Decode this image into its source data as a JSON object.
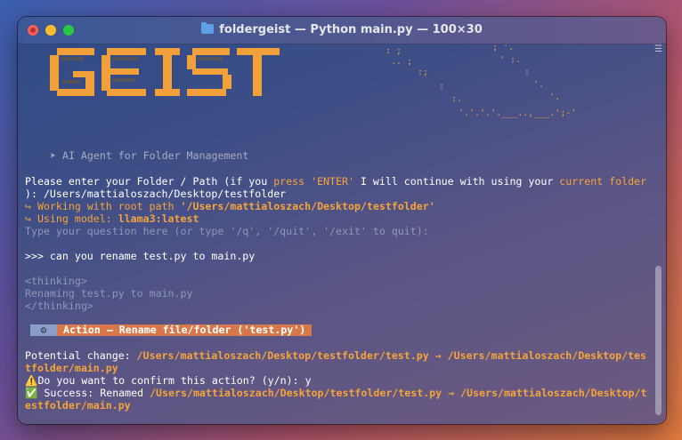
{
  "window": {
    "title": "foldergeist — Python main.py — 100×30"
  },
  "banner": {
    "subtitle": "➤ AI Agent for Folder Management"
  },
  "terminal": {
    "prompt_line1_a": "Please enter your Folder / Path (if you ",
    "prompt_line1_b": "press 'ENTER'",
    "prompt_line1_c": " I will continue with using your ",
    "prompt_line1_d": "current folder",
    "prompt_line2": "): /Users/mattialoszach/Desktop/testfolder",
    "working_prefix": "↪ Working with root path ",
    "working_path": "'/Users/mattialoszach/Desktop/testfolder'",
    "model_prefix": "↪ Using model: ",
    "model_name": "llama3:latest",
    "hint": "Type your question here (or type '/q', '/quit', '/exit' to quit):",
    "user_query": ">>> can you rename test.py to main.py",
    "thinking_open": "<thinking>",
    "thinking_body": "Renaming test.py to main.py",
    "thinking_close": "</thinking>",
    "action_gear": "⚙",
    "action_label": " Action – Rename file/folder ('test.py')",
    "potential_prefix": "Potential change: ",
    "potential_line1": "/Users/mattialoszach/Desktop/testfolder/test.py → /Users/mattialoszach/Desktop/tes",
    "potential_line2": "tfolder/main.py",
    "confirm_icon": "⚠️",
    "confirm_text": "Do you want to confirm this action? (y/n): y",
    "success_icon": "✅",
    "success_prefix": " Success: Renamed ",
    "success_line1": "/Users/mattialoszach/Desktop/testfolder/test.py → /Users/mattialoszach/Desktop/t",
    "success_line2": "estfolder/main.py",
    "final_prompt": ">>> "
  },
  "colors": {
    "accent_orange": "#f5a43a",
    "action_bar": "#d8784a",
    "grey_text": "#8f98b5"
  }
}
